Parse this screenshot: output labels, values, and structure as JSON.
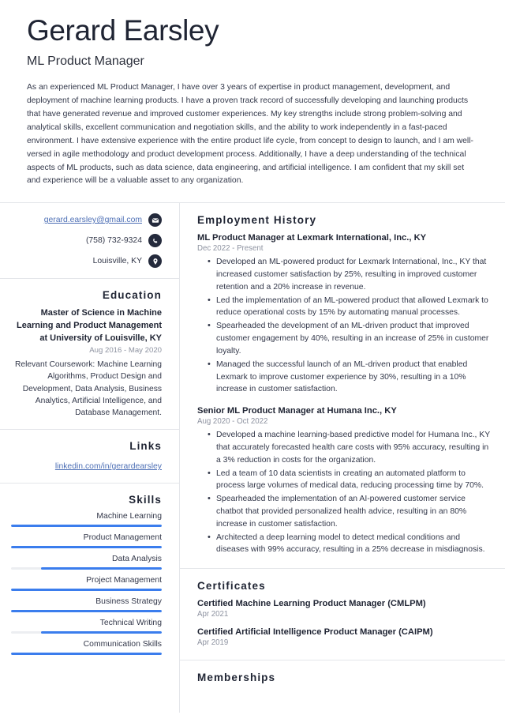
{
  "header": {
    "name": "Gerard Earsley",
    "job_title": "ML Product Manager",
    "summary": "As an experienced ML Product Manager, I have over 3 years of expertise in product management, development, and deployment of machine learning products. I have a proven track record of successfully developing and launching products that have generated revenue and improved customer experiences. My key strengths include strong problem-solving and analytical skills, excellent communication and negotiation skills, and the ability to work independently in a fast-paced environment. I have extensive experience with the entire product life cycle, from concept to design to launch, and I am well-versed in agile methodology and product development process. Additionally, I have a deep understanding of the technical aspects of ML products, such as data science, data engineering, and artificial intelligence. I am confident that my skill set and experience will be a valuable asset to any organization."
  },
  "contact": {
    "email": "gerard.earsley@gmail.com",
    "phone": "(758) 732-9324",
    "location": "Louisville, KY"
  },
  "education": {
    "title": "Education",
    "entries": [
      {
        "degree": "Master of Science in Machine Learning and Product Management at University of Louisville, KY",
        "date": "Aug 2016 - May 2020",
        "description": "Relevant Coursework: Machine Learning Algorithms, Product Design and Development, Data Analysis, Business Analytics, Artificial Intelligence, and Database Management."
      }
    ]
  },
  "links": {
    "title": "Links",
    "items": [
      {
        "label": "linkedin.com/in/gerardearsley"
      }
    ]
  },
  "skills": {
    "title": "Skills",
    "items": [
      {
        "name": "Machine Learning",
        "level": 100
      },
      {
        "name": "Product Management",
        "level": 100
      },
      {
        "name": "Data Analysis",
        "level": 80
      },
      {
        "name": "Project Management",
        "level": 100
      },
      {
        "name": "Business Strategy",
        "level": 100
      },
      {
        "name": "Technical Writing",
        "level": 80
      },
      {
        "name": "Communication Skills",
        "level": 100
      }
    ]
  },
  "employment": {
    "title": "Employment History",
    "entries": [
      {
        "title": "ML Product Manager at Lexmark International, Inc., KY",
        "date": "Dec 2022 - Present",
        "bullets": [
          "Developed an ML-powered product for Lexmark International, Inc., KY that increased customer satisfaction by 25%, resulting in improved customer retention and a 20% increase in revenue.",
          "Led the implementation of an ML-powered product that allowed Lexmark to reduce operational costs by 15% by automating manual processes.",
          "Spearheaded the development of an ML-driven product that improved customer engagement by 40%, resulting in an increase of 25% in customer loyalty.",
          "Managed the successful launch of an ML-driven product that enabled Lexmark to improve customer experience by 30%, resulting in a 10% increase in customer satisfaction."
        ]
      },
      {
        "title": "Senior ML Product Manager at Humana Inc., KY",
        "date": "Aug 2020 - Oct 2022",
        "bullets": [
          "Developed a machine learning-based predictive model for Humana Inc., KY that accurately forecasted health care costs with 95% accuracy, resulting in a 3% reduction in costs for the organization.",
          "Led a team of 10 data scientists in creating an automated platform to process large volumes of medical data, reducing processing time by 70%.",
          "Spearheaded the implementation of an AI-powered customer service chatbot that provided personalized health advice, resulting in an 80% increase in customer satisfaction.",
          "Architected a deep learning model to detect medical conditions and diseases with 99% accuracy, resulting in a 25% decrease in misdiagnosis."
        ]
      }
    ]
  },
  "certificates": {
    "title": "Certificates",
    "entries": [
      {
        "title": "Certified Machine Learning Product Manager (CMLPM)",
        "date": "Apr 2021"
      },
      {
        "title": "Certified Artificial Intelligence Product Manager (CAIPM)",
        "date": "Apr 2019"
      }
    ]
  },
  "memberships": {
    "title": "Memberships"
  },
  "icons": {
    "email": "envelope-icon",
    "phone": "phone-icon",
    "location": "location-pin-icon"
  },
  "colors": {
    "accent": "#3b7ded",
    "heading": "#1f2433",
    "muted": "#8d92a0",
    "link": "#4d6fb5",
    "icon_bg": "#242a3c"
  }
}
